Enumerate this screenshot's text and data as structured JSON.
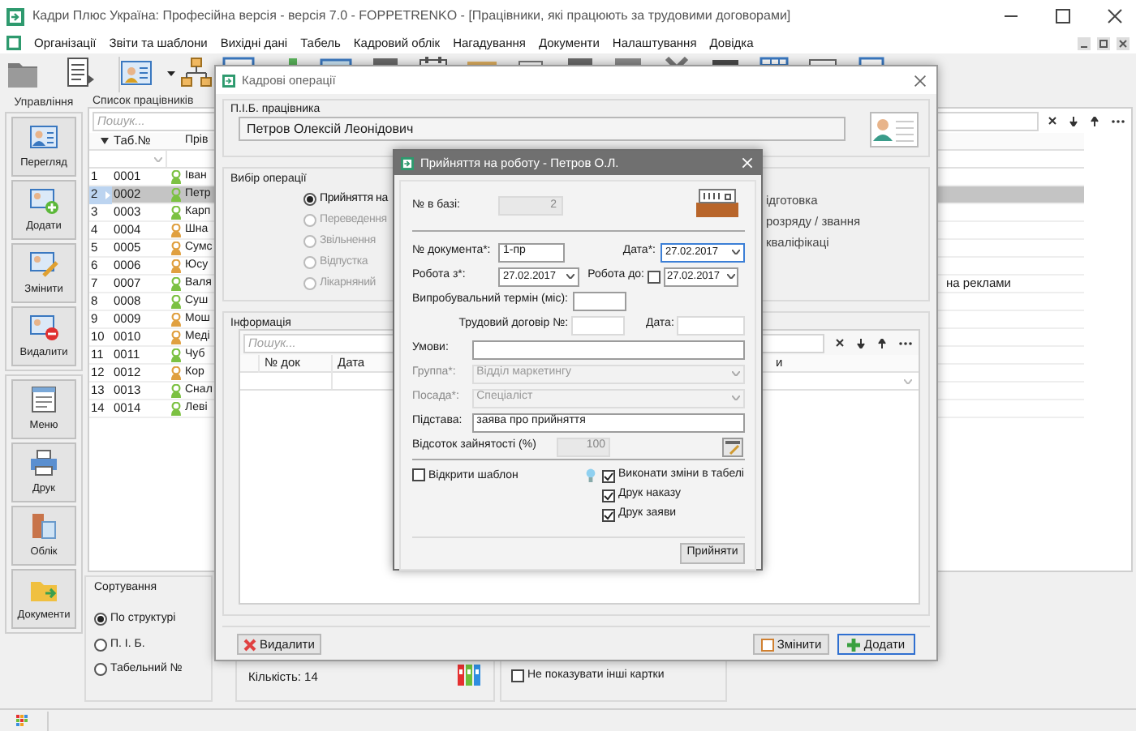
{
  "window": {
    "title": "Кадри Плюс Україна: Професійна версія - версія 7.0 - FOPPETRENKO - [Працівники, які працюють за трудовими договорами]"
  },
  "menu": [
    "Організації",
    "Звіти та шаблони",
    "Вихідні дані",
    "Табель",
    "Кадровий облік",
    "Нагадування",
    "Документи",
    "Налаштування",
    "Довідка"
  ],
  "sidebar": {
    "title": "Управління",
    "buttons": [
      "Перегляд",
      "Додати",
      "Змінити",
      "Видалити",
      "Меню",
      "Друк",
      "Облік",
      "Документи"
    ]
  },
  "employee_list": {
    "title": "Список працівників",
    "search_placeholder": "Пошук...",
    "columns": [
      "Таб.№",
      "Прів"
    ],
    "rows": [
      {
        "number": "1",
        "tab_number": "0001",
        "name": "Іван",
        "color": "#7cc142",
        "selected": false
      },
      {
        "number": "2",
        "tab_number": "0002",
        "name": "Петр",
        "color": "#7cc142",
        "selected": true
      },
      {
        "number": "3",
        "tab_number": "0003",
        "name": "Карп",
        "color": "#7cc142",
        "selected": false
      },
      {
        "number": "4",
        "tab_number": "0004",
        "name": "Шна",
        "color": "#e0a040",
        "selected": false
      },
      {
        "number": "5",
        "tab_number": "0005",
        "name": "Сумс",
        "color": "#e0a040",
        "selected": false
      },
      {
        "number": "6",
        "tab_number": "0006",
        "name": "Юсу",
        "color": "#e0a040",
        "selected": false
      },
      {
        "number": "7",
        "tab_number": "0007",
        "name": "Валя",
        "color": "#7cc142",
        "selected": false,
        "column_3": "на реклами"
      },
      {
        "number": "8",
        "tab_number": "0008",
        "name": "Суш",
        "color": "#7cc142",
        "selected": false
      },
      {
        "number": "9",
        "tab_number": "0009",
        "name": "Мош",
        "color": "#e0a040",
        "selected": false
      },
      {
        "number": "10",
        "tab_number": "0010",
        "name": "Меді",
        "color": "#e0a040",
        "selected": false
      },
      {
        "number": "11",
        "tab_number": "0011",
        "name": "Чуб",
        "color": "#7cc142",
        "selected": false
      },
      {
        "number": "12",
        "tab_number": "0012",
        "name": "Кор",
        "color": "#e0a040",
        "selected": false
      },
      {
        "number": "13",
        "tab_number": "0013",
        "name": "Снал",
        "color": "#7cc142",
        "selected": false
      },
      {
        "number": "14",
        "tab_number": "0014",
        "name": "Леві",
        "color": "#7cc142",
        "selected": false
      }
    ]
  },
  "sorting": {
    "title": "Сортування",
    "options": [
      {
        "label": "По структурі",
        "selected": true
      },
      {
        "label": "П. І. Б.",
        "selected": false
      },
      {
        "label": "Табельний №",
        "selected": false
      }
    ]
  },
  "count": "Кількість: 14",
  "hide_other_cards": {
    "label": "Не показувати інші картки",
    "checked": false
  },
  "hr_operations": {
    "title": "Кадрові операції",
    "employee_label": "П.І.Б. працівника",
    "employee_name": "Петров Олексій Леонідович",
    "operations_title": "Вибір операції",
    "operations": [
      {
        "label": "Прийняття на",
        "selected": true,
        "disabled": false
      },
      {
        "label": "Переведення",
        "selected": false,
        "disabled": true
      },
      {
        "label": "Звільнення",
        "selected": false,
        "disabled": true
      },
      {
        "label": "Відпустка",
        "selected": false,
        "disabled": true
      },
      {
        "label": "Лікарняний",
        "selected": false,
        "disabled": true
      }
    ],
    "operations_right": [
      "ідготовка",
      "розряду / звання",
      "кваліфікаці"
    ],
    "info_title": "Інформація",
    "info_search_placeholder": "Пошук...",
    "info_columns": [
      "№ док",
      "Дата",
      "и"
    ],
    "delete_button": "Видалити",
    "edit_button": "Змінити",
    "add_button": "Додати"
  },
  "hire_dialog": {
    "title": "Прийняття на роботу - Петров О.Л.",
    "db_number_label": "№ в базі:",
    "db_number": "2",
    "doc_number_label": "№ документа*:",
    "doc_number": "1-пр",
    "date_label": "Дата*:",
    "date": "27.02.2017",
    "work_from_label": "Робота з*:",
    "work_from": "27.02.2017",
    "work_to_label": "Робота до:",
    "work_to_enabled": false,
    "work_to": "27.02.2017",
    "probation_label": "Випробувальний термін (міс):",
    "contract_label": "Трудовий договір №:",
    "contract_date_label": "Дата:",
    "conditions_label": "Умови:",
    "group_label": "Группа*:",
    "group": "Відділ маркетингу",
    "position_label": "Посада*:",
    "position": "Спеціаліст",
    "basis_label": "Підстава:",
    "basis": "заява про прийняття",
    "employment_label": "Відсоток зайнятості (%)",
    "employment": "100",
    "open_template": {
      "label": "Відкрити шаблон",
      "checked": false
    },
    "options": [
      {
        "label": "Виконати зміни в табелі",
        "checked": true
      },
      {
        "label": "Друк наказу",
        "checked": true
      },
      {
        "label": "Друк заяви",
        "checked": true
      }
    ],
    "accept_button": "Прийняти"
  }
}
